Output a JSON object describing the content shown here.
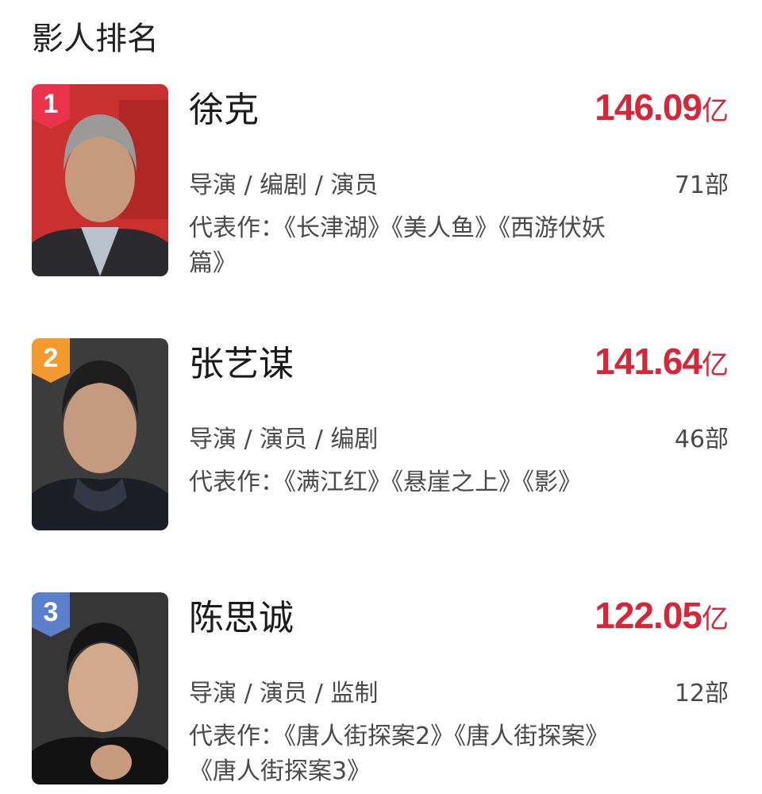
{
  "page": {
    "title": "影人排名"
  },
  "rankings": [
    {
      "rank": "1",
      "name": "徐克",
      "gross": "146.09",
      "unit": "亿",
      "roles": "导演 / 编剧 / 演员",
      "count": "71部",
      "works": "代表作：《长津湖》《美人鱼》《西游伏妖篇》",
      "badge_color": "#e8334a",
      "photo_bg": "#c8312f"
    },
    {
      "rank": "2",
      "name": "张艺谋",
      "gross": "141.64",
      "unit": "亿",
      "roles": "导演 / 演员 / 编剧",
      "count": "46部",
      "works": "代表作：《满江红》《悬崖之上》《影》",
      "badge_color": "#f29a2e",
      "photo_bg": "#3a3a3a"
    },
    {
      "rank": "3",
      "name": "陈思诚",
      "gross": "122.05",
      "unit": "亿",
      "roles": "导演 / 演员 / 监制",
      "count": "12部",
      "works": "代表作：《唐人街探案2》《唐人街探案》《唐人街探案3》",
      "badge_color": "#5b80c9",
      "photo_bg": "#2a2a2a"
    }
  ]
}
